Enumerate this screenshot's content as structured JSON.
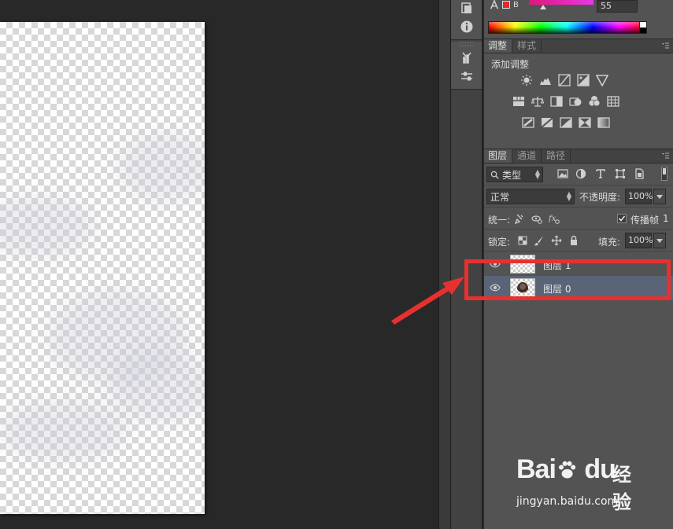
{
  "color_panel": {
    "channel_letter": "B",
    "channel_value": "55"
  },
  "adjustments_panel": {
    "tabs": [
      "调整",
      "样式"
    ],
    "title": "添加调整"
  },
  "layers_panel": {
    "tabs": [
      "图层",
      "通道",
      "路径"
    ],
    "filter_kind": "类型",
    "blend_mode": "正常",
    "opacity_label": "不透明度:",
    "opacity_value": "100%",
    "unify_label": "统一:",
    "propagate_label": "传播帧",
    "propagate_value": "1",
    "propagate_checked": true,
    "lock_label": "锁定:",
    "fill_label": "填充:",
    "fill_value": "100%",
    "layers": [
      {
        "name": "图层 1",
        "selected": false
      },
      {
        "name": "图层 0",
        "selected": true
      }
    ]
  },
  "annotation": {
    "highlight_color": "#e8312f"
  },
  "watermark": {
    "logo_text": "Bai",
    "logo_text_end": "du",
    "brand_cn": "经验",
    "url": "jingyan.baidu.com"
  },
  "colors": {
    "selected_layer_bg": "#596477",
    "panel_bg": "#535353",
    "workspace_bg": "#282828"
  }
}
